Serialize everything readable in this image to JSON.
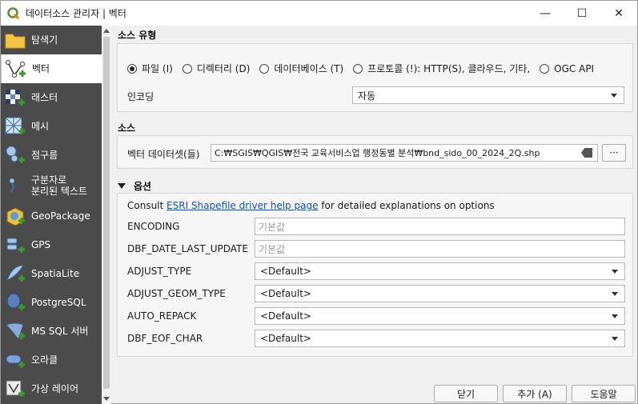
{
  "window": {
    "title": "데이터소스 관리자 | 벡터",
    "minimize": "—",
    "maximize": "☐",
    "close": "✕"
  },
  "sidebar": {
    "items": [
      {
        "label": "탐색기",
        "icon": "folder-icon"
      },
      {
        "label": "벡터",
        "icon": "vector-icon",
        "active": true
      },
      {
        "label": "래스터",
        "icon": "raster-icon"
      },
      {
        "label": "메시",
        "icon": "mesh-icon"
      },
      {
        "label": "점구름",
        "icon": "pointcloud-icon"
      },
      {
        "label": "구분자로",
        "label2": "분리된 텍스트",
        "icon": "delimited-text-icon"
      },
      {
        "label": "GeoPackage",
        "icon": "geopackage-icon"
      },
      {
        "label": "GPS",
        "icon": "gps-icon"
      },
      {
        "label": "SpatiaLite",
        "icon": "spatialite-icon"
      },
      {
        "label": "PostgreSQL",
        "icon": "postgresql-icon"
      },
      {
        "label": "MS SQL 서버",
        "icon": "mssql-icon"
      },
      {
        "label": "오라클",
        "icon": "oracle-icon"
      },
      {
        "label": "가상 레이어",
        "icon": "virtual-layer-icon"
      }
    ]
  },
  "source_type": {
    "title": "소스 유형",
    "options": [
      {
        "label": "파일 (I)",
        "checked": true
      },
      {
        "label": "디렉터리 (D)",
        "checked": false
      },
      {
        "label": "데이터베이스 (T)",
        "checked": false
      },
      {
        "label": "프로토콜 (!): HTTP(S), 클라우드, 기타,",
        "checked": false
      },
      {
        "label": "OGC API",
        "checked": false
      }
    ],
    "encoding_label": "인코딩",
    "encoding_value": "자동"
  },
  "source": {
    "title": "소스",
    "dataset_label": "벡터 데이터셋(들)",
    "dataset_value": "C:₩SGIS₩QGIS₩전국 교육서비스업 행정동별 분석₩bnd_sido_00_2024_2Q.shp",
    "browse_label": "···"
  },
  "options": {
    "title": "옵션",
    "consult_prefix": "Consult ",
    "consult_link": "ESRI Shapefile driver help page",
    "consult_suffix": " for detailed explanations on options",
    "rows": [
      {
        "label": "ENCODING",
        "kind": "input",
        "value": "기본값"
      },
      {
        "label": "DBF_DATE_LAST_UPDATE",
        "kind": "input",
        "value": "기본값"
      },
      {
        "label": "ADJUST_TYPE",
        "kind": "select",
        "value": "<Default>"
      },
      {
        "label": "ADJUST_GEOM_TYPE",
        "kind": "select",
        "value": "<Default>"
      },
      {
        "label": "AUTO_REPACK",
        "kind": "select",
        "value": "<Default>"
      },
      {
        "label": "DBF_EOF_CHAR",
        "kind": "select",
        "value": "<Default>"
      }
    ]
  },
  "buttons": {
    "close": "닫기",
    "add": "추가 (A)",
    "help": "도움말"
  }
}
